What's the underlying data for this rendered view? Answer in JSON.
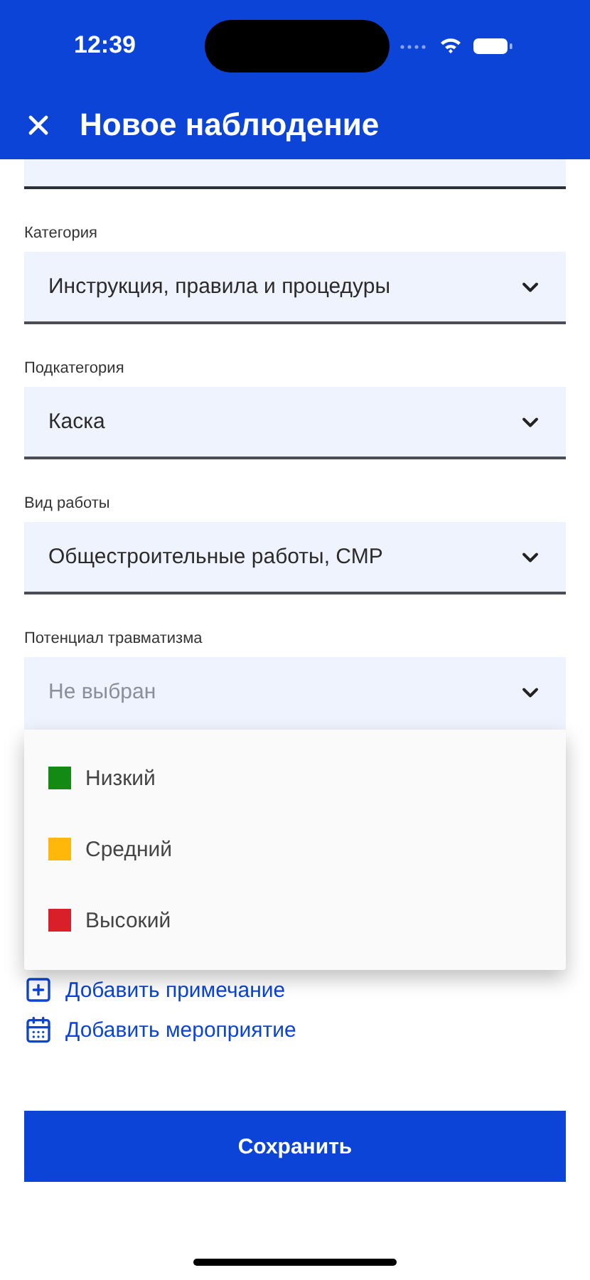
{
  "status_bar": {
    "time": "12:39"
  },
  "header": {
    "title": "Новое наблюдение"
  },
  "fields": [
    {
      "label": "Категория",
      "value": "Инструкция, правила и процедуры",
      "expanded": false
    },
    {
      "label": "Подкатегория",
      "value": "Каска",
      "expanded": false
    },
    {
      "label": "Вид работы",
      "value": "Общестроительные работы, СМР",
      "expanded": false
    },
    {
      "label": "Потенциал травматизма",
      "placeholder": "Не выбран",
      "expanded": true
    }
  ],
  "dropdown_menu": {
    "options": [
      {
        "label": "Низкий",
        "color": "#138a13"
      },
      {
        "label": "Средний",
        "color": "#ffb70a"
      },
      {
        "label": "Высокий",
        "color": "#d9202a"
      }
    ]
  },
  "links": [
    {
      "label": "Добавить примечание",
      "kind": "note"
    },
    {
      "label": "Добавить мероприятие",
      "kind": "calendar"
    }
  ],
  "save_button": "Сохранить"
}
